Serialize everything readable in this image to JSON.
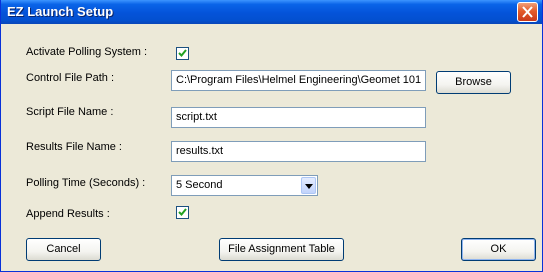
{
  "window": {
    "title": "EZ Launch Setup"
  },
  "form": {
    "activate_polling": {
      "label": "Activate Polling System :",
      "checked": true
    },
    "control_file_path": {
      "label": "Control File Path :",
      "value": "C:\\Program Files\\Helmel Engineering\\Geomet 101",
      "browse_label": "Browse"
    },
    "script_file_name": {
      "label": "Script File Name :",
      "value": "script.txt"
    },
    "results_file_name": {
      "label": "Results File Name :",
      "value": "results.txt"
    },
    "polling_time": {
      "label": "Polling Time (Seconds) :",
      "selected": "5 Second"
    },
    "append_results": {
      "label": "Append Results :",
      "checked": true
    }
  },
  "footer": {
    "cancel_label": "Cancel",
    "file_assignment_label": "File Assignment Table",
    "ok_label": "OK"
  },
  "icons": {
    "close": "close-icon",
    "checkmark": "checkmark-icon",
    "dropdown": "chevron-down-icon"
  },
  "colors": {
    "titlebar": "#0453d9",
    "window_bg": "#ece9d8",
    "close_button": "#e35b2a",
    "field_border": "#7f9db9"
  }
}
